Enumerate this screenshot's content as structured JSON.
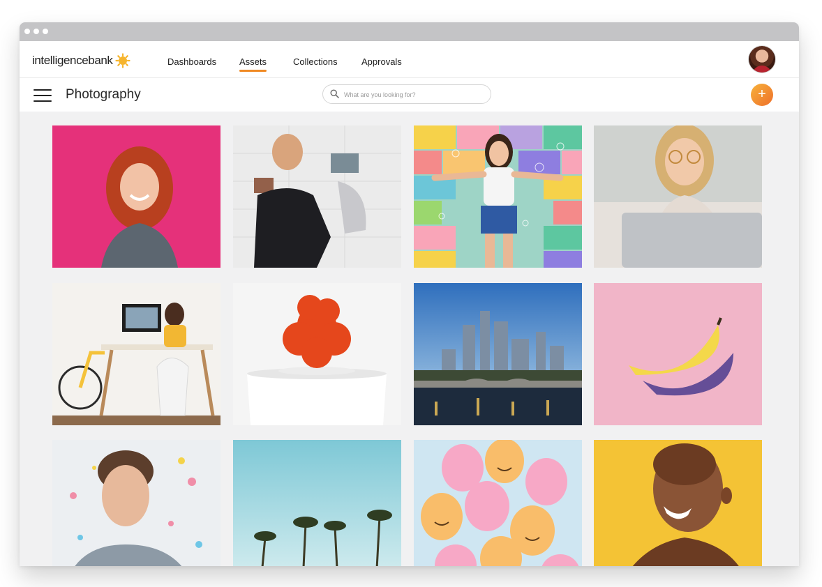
{
  "brand": {
    "logo_part1": "intelligence",
    "logo_part2": "bank",
    "accent_color": "#f08a24"
  },
  "nav": {
    "items": [
      {
        "label": "Dashboards",
        "active": false
      },
      {
        "label": "Assets",
        "active": true
      },
      {
        "label": "Collections",
        "active": false
      },
      {
        "label": "Approvals",
        "active": false
      }
    ]
  },
  "header": {
    "title": "Photography",
    "search_placeholder": "What are you looking for?",
    "add_button_label": "+"
  },
  "assets": {
    "tiles": [
      {
        "icon": "photo-woman-red-hair-pink-wall"
      },
      {
        "icon": "photo-man-pinning-photos"
      },
      {
        "icon": "photo-woman-bubbles-colored-bricks"
      },
      {
        "icon": "photo-woman-laptop-glasses"
      },
      {
        "icon": "photo-desk-workspace-bicycle"
      },
      {
        "icon": "photo-red-plant-white-pot"
      },
      {
        "icon": "photo-city-skyline-bridge"
      },
      {
        "icon": "photo-banana-pink-background"
      },
      {
        "icon": "photo-young-man-confetti"
      },
      {
        "icon": "photo-palm-trees-blue-sky"
      },
      {
        "icon": "photo-smiley-balloons"
      },
      {
        "icon": "photo-laughing-woman-yellow"
      }
    ]
  }
}
